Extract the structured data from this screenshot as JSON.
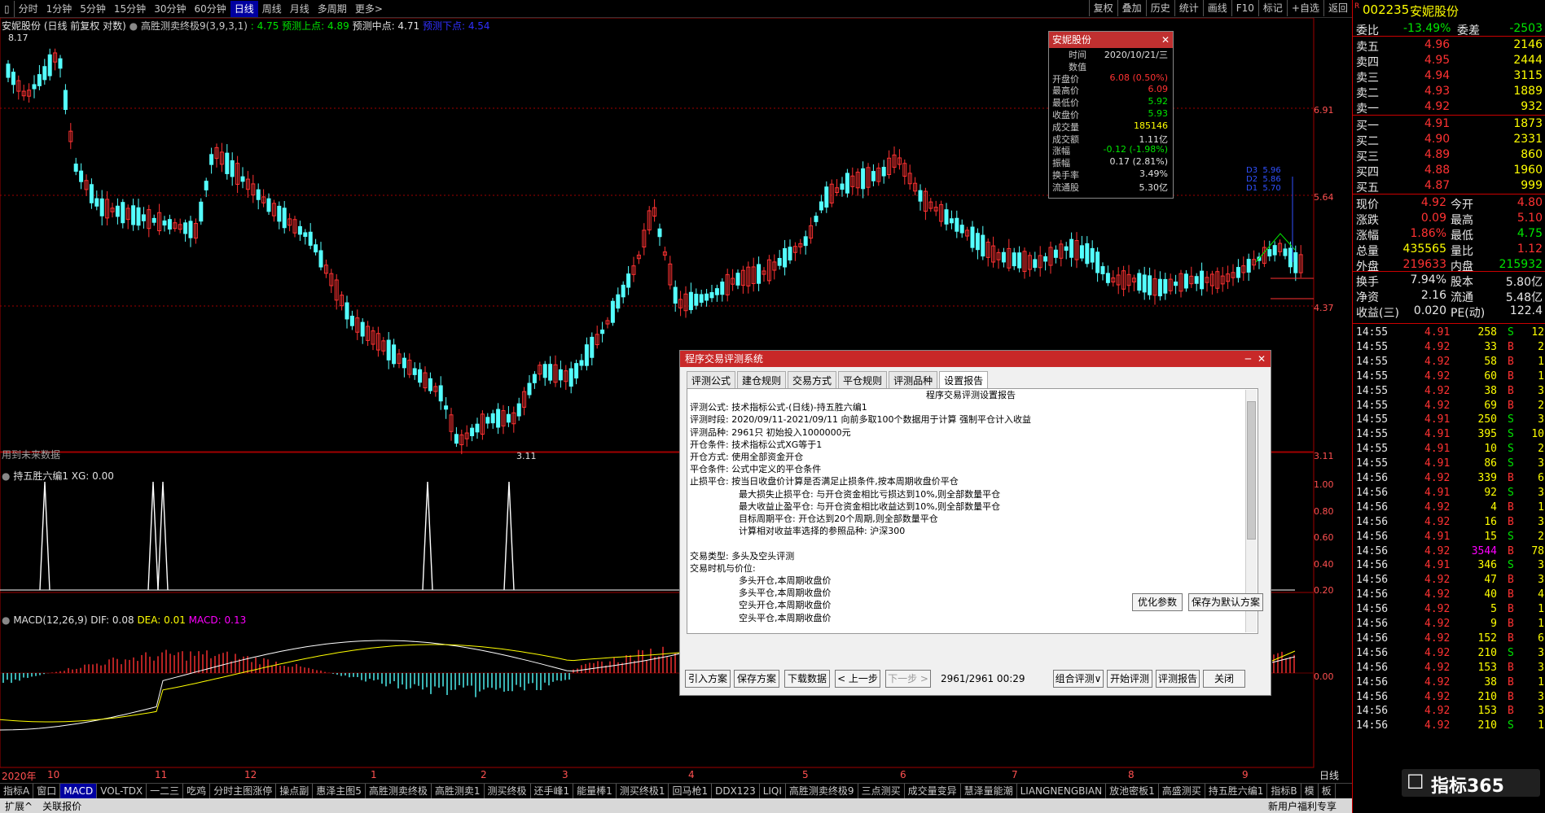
{
  "toolbar": {
    "left": [
      "分时",
      "1分钟",
      "5分钟",
      "15分钟",
      "30分钟",
      "60分钟",
      "日线",
      "周线",
      "月线",
      "多周期",
      "更多>"
    ],
    "active": "日线",
    "right": [
      "复权",
      "叠加",
      "历史",
      "统计",
      "画线",
      "F10",
      "标记",
      "+自选",
      "返回"
    ]
  },
  "main_legend": {
    "name": "安妮股份 (日线 前复权 对数)",
    "indicator": "高胜测卖终极9(3,9,3,1)",
    "v1": ": 4.75",
    "v2": "预测上点: 4.89",
    "v3": "预测中点: 4.71",
    "v4": "预测下点: 4.54",
    "note": "用到未来数据",
    "high_mark": "8.17",
    "low_mark": "3.11"
  },
  "main_yaxis": [
    "6.91",
    "5.64",
    "4.37",
    "3.11"
  ],
  "pred_labels": {
    "d1": "D3",
    "d2": "D2",
    "d3": "D1",
    "v1": "5.96",
    "v2": "5.86",
    "v3": "5.70"
  },
  "sub1": {
    "legend": "持五胜六编1 XG: 0.00",
    "yaxis": [
      "1.00",
      "0.80",
      "0.60",
      "0.40",
      "0.20"
    ]
  },
  "sub2": {
    "legend_name": "MACD(12,26,9)",
    "dif": "DIF: 0.08",
    "dea": "DEA: 0.01",
    "macd": "MACD: 0.13",
    "yaxis": "0.00"
  },
  "xaxis": [
    "2020年",
    "10",
    "11",
    "12",
    "1",
    "2",
    "3",
    "4",
    "5",
    "6",
    "7",
    "8",
    "9"
  ],
  "period_label": "日线",
  "bottom_tabs": [
    "指标A",
    "窗口",
    "MACD",
    "VOL-TDX",
    "一二三",
    "吃鸡",
    "分时主图涨停",
    "操点副",
    "惠泽主图5",
    "高胜测卖终极",
    "高胜测卖1",
    "测买终极",
    "还手峰1",
    "能量棒1",
    "测买终极1",
    "回马枪1",
    "DDX123",
    "LIQI",
    "高胜测卖终极9",
    "三点测买",
    "成交量变异",
    "慧泽量能潮",
    "LIANGNENGBIAN",
    "放池密板1",
    "高盛测买",
    "持五胜六编1",
    "指标B",
    "模",
    "板"
  ],
  "bottom_active": "MACD",
  "status": [
    "扩展^",
    "关联报价"
  ],
  "status_right": "新用户福利专享",
  "infobox": {
    "title": "安妮股份",
    "rows": [
      {
        "k": "时间",
        "v": "2020/10/21/三",
        "c": "white"
      },
      {
        "k": "数值",
        "v": "",
        "c": "white"
      },
      {
        "k": "开盘价",
        "v": "6.08 (0.50%)",
        "c": "red"
      },
      {
        "k": "最高价",
        "v": "6.09",
        "c": "red"
      },
      {
        "k": "最低价",
        "v": "5.92",
        "c": "green"
      },
      {
        "k": "收盘价",
        "v": "5.93",
        "c": "green"
      },
      {
        "k": "成交量",
        "v": "185146",
        "c": "yellow"
      },
      {
        "k": "成交额",
        "v": "1.11亿",
        "c": "white"
      },
      {
        "k": "涨幅",
        "v": "-0.12 (-1.98%)",
        "c": "green"
      },
      {
        "k": "振幅",
        "v": "0.17 (2.81%)",
        "c": "white"
      },
      {
        "k": "换手率",
        "v": "3.49%",
        "c": "white"
      },
      {
        "k": "流通股",
        "v": "5.30亿",
        "c": "white"
      }
    ]
  },
  "dialog": {
    "title": "程序交易评测系统",
    "tabs": [
      "评测公式",
      "建仓规则",
      "交易方式",
      "平仓规则",
      "评测品种",
      "设置报告"
    ],
    "active_tab": "设置报告",
    "report_title": "程序交易评测设置报告",
    "lines": [
      "评测公式: 技术指标公式-(日线)-持五胜六编1",
      "评测时段: 2020/09/11-2021/09/11 向前多取100个数据用于计算 强制平仓计入收益",
      "评测品种: 2961只 初始投入1000000元",
      "开仓条件: 技术指标公式XG等于1",
      "开仓方式: 使用全部资金开仓",
      "平仓条件: 公式中定义的平仓条件",
      "止损平仓: 按当日收盘价计算是否满足止损条件,按本周期收盘价平仓",
      "最大损失止损平仓: 与开仓资金相比亏损达到10%,则全部数量平仓",
      "最大收益止盈平仓: 与开仓资金相比收益达到10%,则全部数量平仓",
      "目标周期平仓: 开仓达到20个周期,则全部数量平仓",
      "计算相对收益率选择的参照品种: 沪深300",
      "",
      "交易类型: 多头及空头评测",
      "交易时机与价位:",
      "多头开仓,本周期收盘价",
      "多头平仓,本周期收盘价",
      "空头开仓,本周期收盘价",
      "空头平仓,本周期收盘价"
    ],
    "btn_opt": "优化参数",
    "btn_save_default": "保存为默认方案",
    "btns": [
      "引入方案",
      "保存方案",
      "下载数据",
      "< 上一步",
      "下一步 >"
    ],
    "progress": "2961/2961  00:29",
    "btns2": [
      "组合评测∨",
      "开始评测",
      "评测报告",
      "关闭"
    ]
  },
  "quote": {
    "code": "002235",
    "name": "安妮股份",
    "weibi_k": "委比",
    "weibi_v": "-13.49%",
    "weicha_k": "委差",
    "weicha_v": "-2503",
    "asks": [
      {
        "k": "卖五",
        "p": "4.96",
        "v": "2146"
      },
      {
        "k": "卖四",
        "p": "4.95",
        "v": "2444"
      },
      {
        "k": "卖三",
        "p": "4.94",
        "v": "3115"
      },
      {
        "k": "卖二",
        "p": "4.93",
        "v": "1889"
      },
      {
        "k": "卖一",
        "p": "4.92",
        "v": "932"
      }
    ],
    "bids": [
      {
        "k": "买一",
        "p": "4.91",
        "v": "1873"
      },
      {
        "k": "买二",
        "p": "4.90",
        "v": "2331"
      },
      {
        "k": "买三",
        "p": "4.89",
        "v": "860"
      },
      {
        "k": "买四",
        "p": "4.88",
        "v": "1960"
      },
      {
        "k": "买五",
        "p": "4.87",
        "v": "999"
      }
    ],
    "stats": [
      {
        "k1": "现价",
        "v1": "4.92",
        "c1": "red",
        "k2": "今开",
        "v2": "4.80",
        "c2": "red"
      },
      {
        "k1": "涨跌",
        "v1": "0.09",
        "c1": "red",
        "k2": "最高",
        "v2": "5.10",
        "c2": "red"
      },
      {
        "k1": "涨幅",
        "v1": "1.86%",
        "c1": "red",
        "k2": "最低",
        "v2": "4.75",
        "c2": "green"
      },
      {
        "k1": "总量",
        "v1": "435565",
        "c1": "yellow",
        "k2": "量比",
        "v2": "1.12",
        "c2": "red"
      },
      {
        "k1": "外盘",
        "v1": "219633",
        "c1": "red",
        "k2": "内盘",
        "v2": "215932",
        "c2": "green"
      },
      {
        "k1": "换手",
        "v1": "7.94%",
        "c1": "white",
        "k2": "股本",
        "v2": "5.80亿",
        "c2": "white"
      },
      {
        "k1": "净资",
        "v1": "2.16",
        "c1": "white",
        "k2": "流通",
        "v2": "5.48亿",
        "c2": "white"
      },
      {
        "k1": "收益(三)",
        "v1": "0.020",
        "c1": "white",
        "k2": "PE(动)",
        "v2": "122.4",
        "c2": "white"
      }
    ]
  },
  "trades": [
    [
      "14:55",
      "4.91",
      "258",
      "S",
      "12"
    ],
    [
      "14:55",
      "4.92",
      "33",
      "B",
      "2"
    ],
    [
      "14:55",
      "4.92",
      "58",
      "B",
      "1"
    ],
    [
      "14:55",
      "4.92",
      "60",
      "B",
      "1"
    ],
    [
      "14:55",
      "4.92",
      "38",
      "B",
      "3"
    ],
    [
      "14:55",
      "4.92",
      "69",
      "B",
      "2"
    ],
    [
      "14:55",
      "4.91",
      "250",
      "S",
      "3"
    ],
    [
      "14:55",
      "4.91",
      "395",
      "S",
      "10"
    ],
    [
      "14:55",
      "4.91",
      "10",
      "S",
      "2"
    ],
    [
      "14:55",
      "4.91",
      "86",
      "S",
      "3"
    ],
    [
      "14:56",
      "4.92",
      "339",
      "B",
      "6"
    ],
    [
      "14:56",
      "4.91",
      "92",
      "S",
      "3"
    ],
    [
      "14:56",
      "4.92",
      "4",
      "B",
      "1"
    ],
    [
      "14:56",
      "4.92",
      "16",
      "B",
      "3"
    ],
    [
      "14:56",
      "4.91",
      "15",
      "S",
      "2"
    ],
    [
      "14:56",
      "4.92",
      "3544",
      "B",
      "78"
    ],
    [
      "14:56",
      "4.91",
      "346",
      "S",
      "3"
    ],
    [
      "14:56",
      "4.92",
      "47",
      "B",
      "3"
    ],
    [
      "14:56",
      "4.92",
      "40",
      "B",
      "4"
    ],
    [
      "14:56",
      "4.92",
      "5",
      "B",
      "1"
    ],
    [
      "14:56",
      "4.92",
      "9",
      "B",
      "1"
    ],
    [
      "14:56",
      "4.92",
      "152",
      "B",
      "6"
    ],
    [
      "14:56",
      "4.92",
      "210",
      "S",
      "3"
    ],
    [
      "14:56",
      "4.92",
      "153",
      "B",
      "3"
    ],
    [
      "14:56",
      "4.92",
      "38",
      "B",
      "1"
    ],
    [
      "14:56",
      "4.92",
      "210",
      "B",
      "3"
    ],
    [
      "14:56",
      "4.92",
      "153",
      "B",
      "3"
    ],
    [
      "14:56",
      "4.92",
      "210",
      "S",
      "1"
    ]
  ],
  "logo": "指标365",
  "colors": {
    "up": "#ff3232",
    "down": "#54ffff",
    "dif": "#ffffff",
    "dea": "#ffff00",
    "accent": "#c82828"
  }
}
